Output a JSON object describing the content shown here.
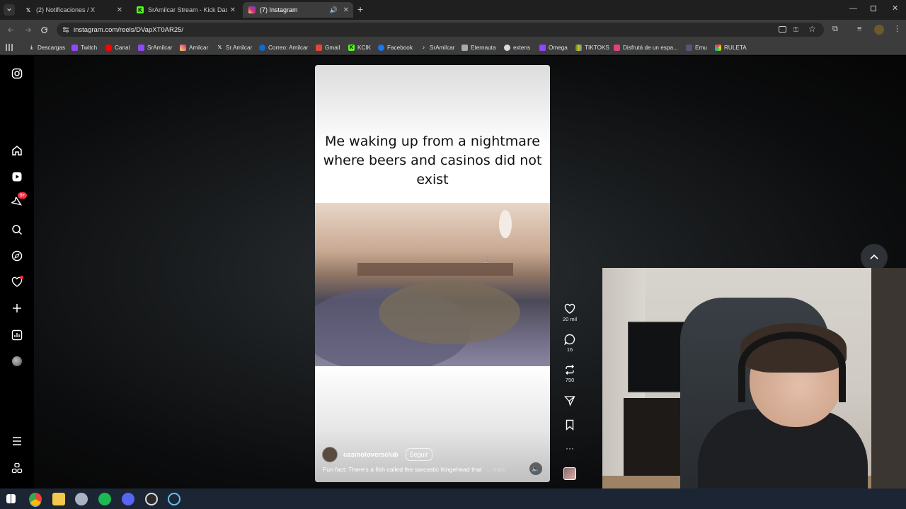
{
  "browser": {
    "tabs": [
      {
        "label": "(2) Notificaciones / X",
        "icon": "x-logo-icon"
      },
      {
        "label": "SrAmilcar Stream - Kick Dashboard",
        "icon": "kick-logo-icon"
      },
      {
        "label": "(7) Instagram",
        "icon": "instagram-logo-icon",
        "active": true
      }
    ],
    "url": "instagram.com/reels/DVapXT0AR25/",
    "bookmarks": [
      "Descargas",
      "Twitch",
      "Canal",
      "SrAmilcar",
      "Amilcar",
      "Sr.Amilcar",
      "Correo: Amilcar",
      "Gmail",
      "KCIK",
      "Facebook",
      "SrAmilcar",
      "Eternauta",
      "extens",
      "Omega",
      "TIKTOKS",
      "Disfrutá de un espa...",
      "Emu",
      "RULETA"
    ]
  },
  "instagram": {
    "notification_badge": "9+",
    "reel": {
      "caption": "Me waking up from a nightmare where beers and casinos did not exist",
      "author": "casinoloversclub",
      "follow_label": "Seguir",
      "description": "Fun fact: There's a fish called the sarcastic fringehead that",
      "more_label": "... más"
    },
    "actions": {
      "likes": "20 mil",
      "comments": "16",
      "reposts": "790"
    }
  },
  "colors": {
    "ig_gradient_start": "#feda75",
    "ig_gradient_end": "#d62976",
    "notification_red": "#ff3040",
    "kick_green": "#53fc18"
  }
}
